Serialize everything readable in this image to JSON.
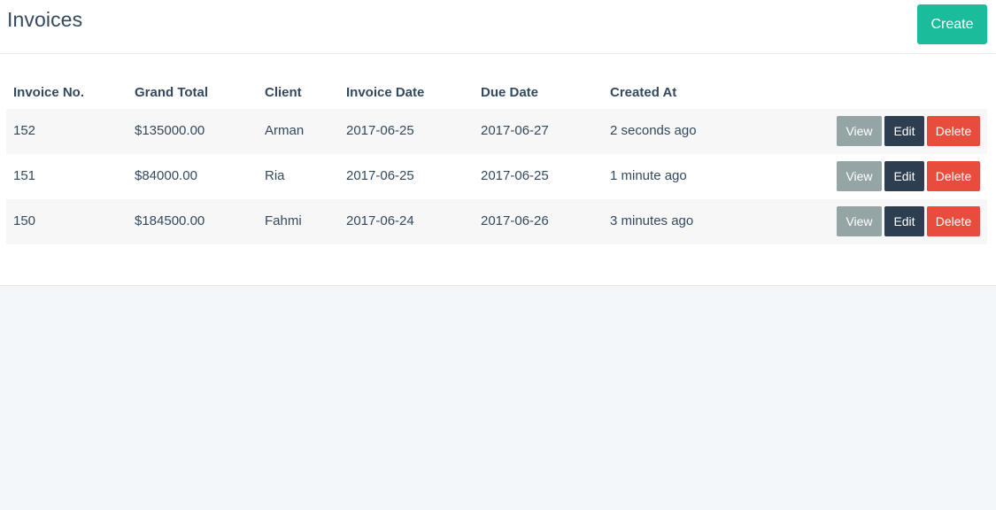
{
  "header": {
    "title": "Invoices",
    "create_label": "Create"
  },
  "table": {
    "columns": [
      "Invoice No.",
      "Grand Total",
      "Client",
      "Invoice Date",
      "Due Date",
      "Created At"
    ],
    "rows": [
      {
        "invoice_no": "152",
        "grand_total": "$135000.00",
        "client": "Arman",
        "invoice_date": "2017-06-25",
        "due_date": "2017-06-27",
        "created_at": "2 seconds ago"
      },
      {
        "invoice_no": "151",
        "grand_total": "$84000.00",
        "client": "Ria",
        "invoice_date": "2017-06-25",
        "due_date": "2017-06-25",
        "created_at": "1 minute ago"
      },
      {
        "invoice_no": "150",
        "grand_total": "$184500.00",
        "client": "Fahmi",
        "invoice_date": "2017-06-24",
        "due_date": "2017-06-26",
        "created_at": "3 minutes ago"
      }
    ],
    "actions": {
      "view_label": "View",
      "edit_label": "Edit",
      "delete_label": "Delete"
    }
  },
  "colors": {
    "create": "#1abc9c",
    "view": "#95a5a6",
    "edit": "#2c3e50",
    "delete": "#e74c3c"
  }
}
